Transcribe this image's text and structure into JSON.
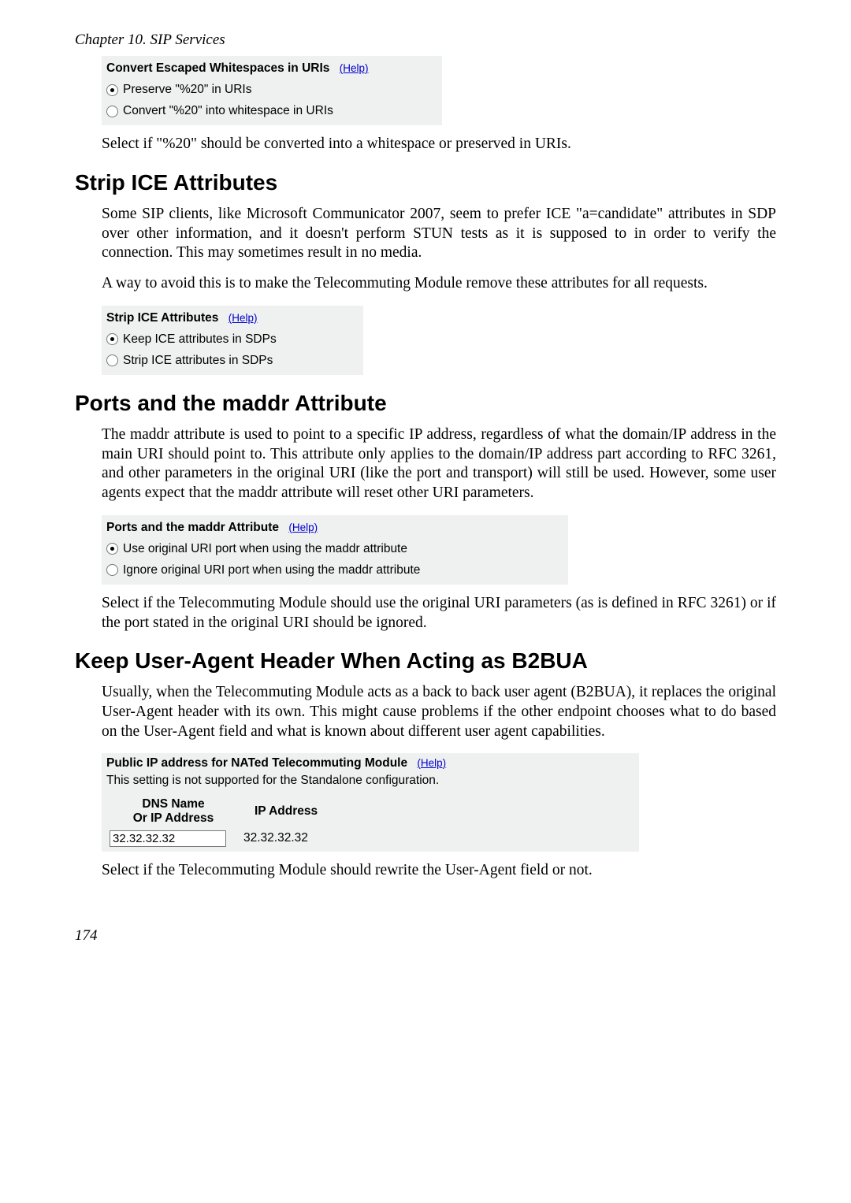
{
  "chapterHeader": "Chapter 10. SIP Services",
  "helpLabel": "(Help)",
  "convertEscaped": {
    "title": "Convert Escaped Whitespaces in URIs",
    "opt1": "Preserve \"%20\" in URIs",
    "opt2": "Convert \"%20\" into whitespace in URIs",
    "desc": "Select if \"%20\" should be converted into a whitespace or preserved in URIs."
  },
  "stripIce": {
    "heading": "Strip ICE Attributes",
    "para1": "Some SIP clients, like Microsoft Communicator 2007, seem to prefer ICE \"a=candidate\" attributes in SDP over other information, and it doesn't perform STUN tests as it is supposed to in order to verify the connection. This may sometimes result in no media.",
    "para2": "A way to avoid this is to make the Telecommuting Module remove these attributes for all requests.",
    "formTitle": "Strip ICE Attributes",
    "opt1": "Keep ICE attributes in SDPs",
    "opt2": "Strip ICE attributes in SDPs"
  },
  "maddr": {
    "heading": "Ports and the maddr Attribute",
    "para1": "The maddr attribute is used to point to a specific IP address, regardless of what the domain/IP address in the main URI should point to. This attribute only applies to the domain/IP address part according to RFC 3261, and other parameters in the original URI (like the port and transport) will still be used. However, some user agents expect that the maddr attribute will reset other URI parameters.",
    "formTitle": "Ports and the maddr Attribute",
    "opt1": "Use original URI port when using the maddr attribute",
    "opt2": "Ignore original URI port when using the maddr attribute",
    "desc": "Select if the Telecommuting Module should use the original URI parameters (as is defined in RFC 3261) or if the port stated in the original URI should be ignored."
  },
  "b2bua": {
    "heading": "Keep User-Agent Header When Acting as B2BUA",
    "para1": "Usually, when the Telecommuting Module acts as a back to back user agent (B2BUA), it replaces the original User-Agent header with its own. This might cause problems if the other endpoint chooses what to do based on the User-Agent field and what is known about different user agent capabilities.",
    "natTitle": "Public IP address for NATed Telecommuting Module",
    "natNote": "This setting is not supported for the Standalone configuration.",
    "col1a": "DNS Name",
    "col1b": "Or IP Address",
    "col2": "IP Address",
    "inputValue": "32.32.32.32",
    "resolved": "32.32.32.32",
    "desc": "Select if the Telecommuting Module should rewrite the User-Agent field or not."
  },
  "pageNumber": "174"
}
